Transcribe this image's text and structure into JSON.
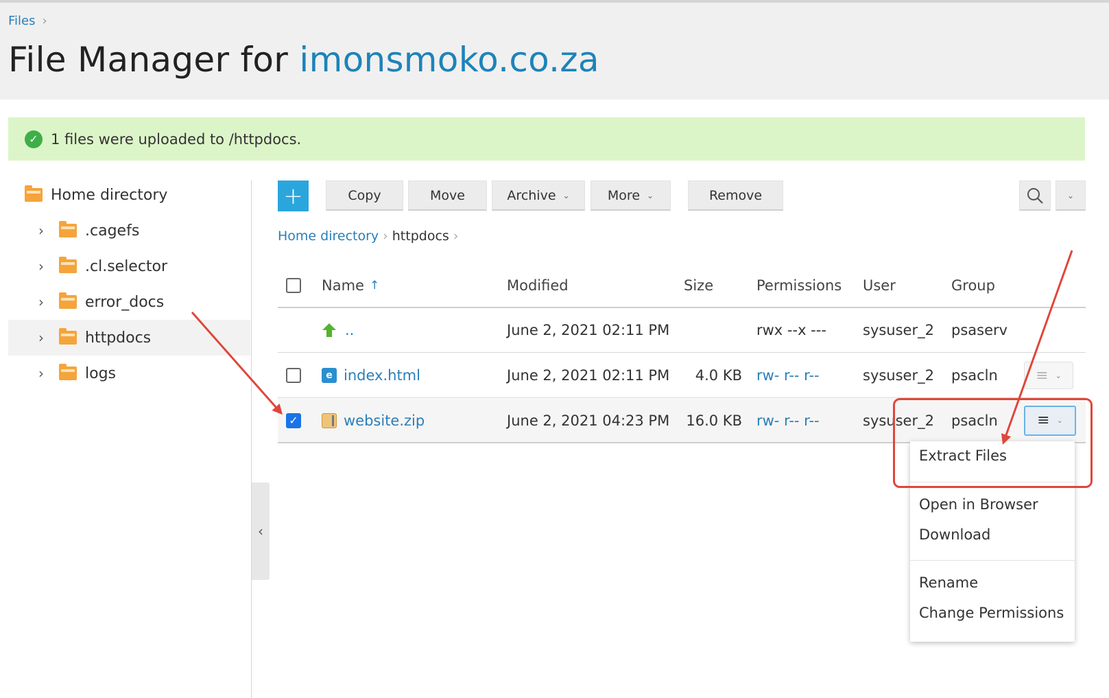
{
  "header": {
    "breadcrumb_root": "Files",
    "title_prefix": "File Manager for",
    "title_domain": "imonsmoko.co.za"
  },
  "message": {
    "text": "1 files were uploaded to /httpdocs.",
    "icon": "check-circle-icon",
    "color": "#3fae49"
  },
  "sidebar": {
    "root": "Home directory",
    "items": [
      {
        "label": ".cagefs"
      },
      {
        "label": ".cl.selector"
      },
      {
        "label": "error_docs"
      },
      {
        "label": "httpdocs"
      },
      {
        "label": "logs"
      }
    ]
  },
  "toolbar": {
    "add_label": "+",
    "copy_label": "Copy",
    "move_label": "Move",
    "archive_label": "Archive",
    "more_label": "More",
    "remove_label": "Remove",
    "accent": "#2aa6dd"
  },
  "content_breadcrumb": {
    "root": "Home directory",
    "current": "httpdocs"
  },
  "table": {
    "columns": {
      "name": "Name",
      "modified": "Modified",
      "size": "Size",
      "permissions": "Permissions",
      "user": "User",
      "group": "Group"
    },
    "rows": [
      {
        "name": "..",
        "modified": "June 2, 2021 02:11 PM",
        "size": "",
        "permissions": "rwx --x ---",
        "user": "sysuser_2",
        "group": "psaserv"
      },
      {
        "name": "index.html",
        "modified": "June 2, 2021 02:11 PM",
        "size": "4.0 KB",
        "permissions": "rw- r-- r--",
        "user": "sysuser_2",
        "group": "psacln"
      },
      {
        "name": "website.zip",
        "modified": "June 2, 2021 04:23 PM",
        "size": "16.0 KB",
        "permissions": "rw- r-- r--",
        "user": "sysuser_2",
        "group": "psacln"
      }
    ]
  },
  "context_menu": {
    "items": [
      "Extract Files",
      "Open in Browser",
      "Download",
      "Rename",
      "Change Permissions"
    ]
  },
  "annotation_color": "#e0463b"
}
